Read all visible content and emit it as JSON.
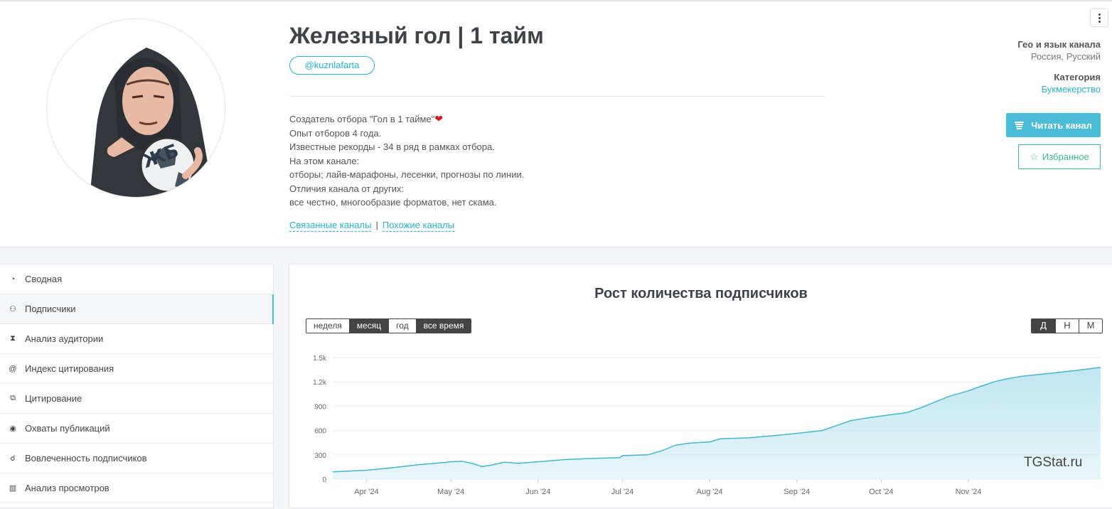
{
  "channel": {
    "title": "Железный гол | 1 тайм",
    "username": "@kuznlafarta",
    "avatar_text": "ЖБ",
    "description": [
      "Создатель отбора \"Гол в 1 тайме\"",
      "Опыт отборов 4 года.",
      "Известные рекорды - 34 в ряд в рамках отбора.",
      "На этом канале:",
      "отборы; лайв-марафоны, лесенки, прогнозы по линии.",
      "Отличия канала от других:",
      "все честно, многообразие форматов, нет скама."
    ],
    "heart": "❤",
    "links": {
      "related": "Связанные каналы",
      "separator": "|",
      "similar": "Похожие каналы"
    }
  },
  "meta": {
    "geo_label": "Гео и язык канала",
    "geo_value": "Россия, Русский",
    "category_label": "Категория",
    "category_value": "Букмекерство"
  },
  "actions": {
    "read": "Читать канал",
    "favorite": "Избранное"
  },
  "sidebar": {
    "items": [
      {
        "label": "Сводная",
        "icon": "dashboard-icon",
        "glyph": "◔"
      },
      {
        "label": "Подписчики",
        "icon": "users-icon",
        "glyph": "⚇",
        "active": true
      },
      {
        "label": "Анализ аудитории",
        "icon": "hourglass-icon",
        "glyph": "⧗"
      },
      {
        "label": "Индекс цитирования",
        "icon": "at-icon",
        "glyph": "@"
      },
      {
        "label": "Цитирование",
        "icon": "copy-icon",
        "glyph": "⧉"
      },
      {
        "label": "Охваты публикаций",
        "icon": "eye-icon",
        "glyph": "◉"
      },
      {
        "label": "Вовлеченность подписчиков",
        "icon": "engagement-icon",
        "glyph": "☌"
      },
      {
        "label": "Анализ просмотров",
        "icon": "bar-chart-icon",
        "glyph": "▥"
      }
    ]
  },
  "panel": {
    "title": "Рост количества подписчиков",
    "periods": [
      {
        "label": "неделя",
        "active": false
      },
      {
        "label": "месяц",
        "active": true
      },
      {
        "label": "год",
        "active": false
      },
      {
        "label": "все время",
        "active": true
      }
    ],
    "scales": [
      {
        "label": "Д",
        "active": true
      },
      {
        "label": "Н",
        "active": false
      },
      {
        "label": "М",
        "active": false
      }
    ],
    "watermark": "TGStat.ru"
  },
  "colors": {
    "accent": "#4bbcd8",
    "favorite": "#3cb896",
    "line": "#46b5cf",
    "area": "#bfe6f0"
  },
  "chart_data": {
    "type": "area",
    "y_tick_labels": [
      "0",
      "300",
      "600",
      "900",
      "1.2k",
      "1.5k"
    ],
    "y_ticks": [
      0,
      300,
      600,
      900,
      1200,
      1500
    ],
    "ylim": [
      0,
      1500
    ],
    "x_tick_labels": [
      "Apr '24",
      "May '24",
      "Jun '24",
      "Jul '24",
      "Aug '24",
      "Sep '24",
      "Oct '24",
      "Nov '24"
    ],
    "x_ticks": [
      "2024-04-01",
      "2024-05-01",
      "2024-06-01",
      "2024-07-01",
      "2024-08-01",
      "2024-09-01",
      "2024-10-01",
      "2024-11-01"
    ],
    "xlim": [
      "2024-03-20",
      "2024-12-18"
    ],
    "grid": true,
    "series": [
      {
        "points": [
          [
            "2024-03-20",
            90
          ],
          [
            "2024-04-01",
            110
          ],
          [
            "2024-04-10",
            140
          ],
          [
            "2024-04-20",
            180
          ],
          [
            "2024-04-30",
            210
          ],
          [
            "2024-05-01",
            215
          ],
          [
            "2024-05-05",
            220
          ],
          [
            "2024-05-09",
            190
          ],
          [
            "2024-05-12",
            155
          ],
          [
            "2024-05-15",
            170
          ],
          [
            "2024-05-20",
            210
          ],
          [
            "2024-05-25",
            195
          ],
          [
            "2024-06-01",
            215
          ],
          [
            "2024-06-10",
            240
          ],
          [
            "2024-06-20",
            255
          ],
          [
            "2024-06-30",
            265
          ],
          [
            "2024-07-01",
            290
          ],
          [
            "2024-07-10",
            300
          ],
          [
            "2024-07-15",
            350
          ],
          [
            "2024-07-20",
            420
          ],
          [
            "2024-07-25",
            445
          ],
          [
            "2024-08-01",
            460
          ],
          [
            "2024-08-05",
            500
          ],
          [
            "2024-08-15",
            510
          ],
          [
            "2024-08-25",
            540
          ],
          [
            "2024-09-01",
            565
          ],
          [
            "2024-09-10",
            600
          ],
          [
            "2024-09-15",
            660
          ],
          [
            "2024-09-20",
            720
          ],
          [
            "2024-09-25",
            750
          ],
          [
            "2024-10-01",
            780
          ],
          [
            "2024-10-10",
            820
          ],
          [
            "2024-10-15",
            880
          ],
          [
            "2024-10-20",
            950
          ],
          [
            "2024-10-25",
            1020
          ],
          [
            "2024-11-01",
            1090
          ],
          [
            "2024-11-05",
            1140
          ],
          [
            "2024-11-10",
            1200
          ],
          [
            "2024-11-15",
            1240
          ],
          [
            "2024-11-20",
            1270
          ],
          [
            "2024-12-01",
            1310
          ],
          [
            "2024-12-10",
            1345
          ],
          [
            "2024-12-18",
            1380
          ]
        ]
      }
    ]
  }
}
